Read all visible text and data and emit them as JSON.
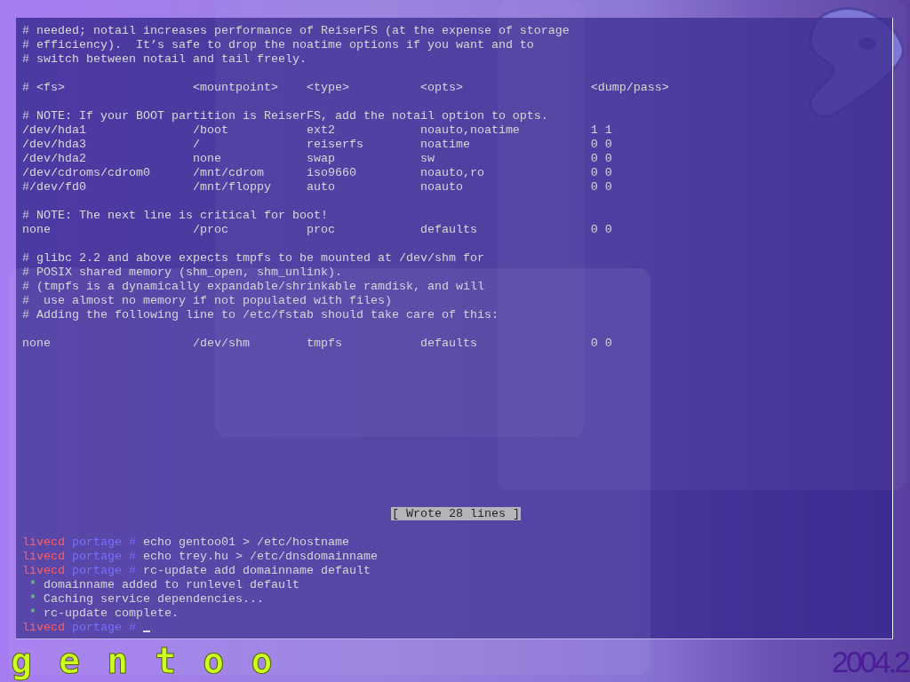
{
  "console": {
    "lines": [
      {
        "kind": "plain",
        "text": "# needed; notail increases performance of ReiserFS (at the expense of storage"
      },
      {
        "kind": "plain",
        "text": "# efficiency).  It’s safe to drop the noatime options if you want and to"
      },
      {
        "kind": "plain",
        "text": "# switch between notail and tail freely."
      },
      {
        "kind": "blank"
      },
      {
        "kind": "plain",
        "text": "# <fs>                  <mountpoint>    <type>          <opts>                  <dump/pass>"
      },
      {
        "kind": "blank"
      },
      {
        "kind": "plain",
        "text": "# NOTE: If your BOOT partition is ReiserFS, add the notail option to opts."
      },
      {
        "kind": "plain",
        "text": "/dev/hda1               /boot           ext2            noauto,noatime          1 1"
      },
      {
        "kind": "plain",
        "text": "/dev/hda3               /               reiserfs        noatime                 0 0"
      },
      {
        "kind": "plain",
        "text": "/dev/hda2               none            swap            sw                      0 0"
      },
      {
        "kind": "plain",
        "text": "/dev/cdroms/cdrom0      /mnt/cdrom      iso9660         noauto,ro               0 0"
      },
      {
        "kind": "plain",
        "text": "#/dev/fd0               /mnt/floppy     auto            noauto                  0 0"
      },
      {
        "kind": "blank"
      },
      {
        "kind": "plain",
        "text": "# NOTE: The next line is critical for boot!"
      },
      {
        "kind": "plain",
        "text": "none                    /proc           proc            defaults                0 0"
      },
      {
        "kind": "blank"
      },
      {
        "kind": "plain",
        "text": "# glibc 2.2 and above expects tmpfs to be mounted at /dev/shm for"
      },
      {
        "kind": "plain",
        "text": "# POSIX shared memory (shm_open, shm_unlink)."
      },
      {
        "kind": "plain",
        "text": "# (tmpfs is a dynamically expandable/shrinkable ramdisk, and will"
      },
      {
        "kind": "plain",
        "text": "#  use almost no memory if not populated with files)"
      },
      {
        "kind": "plain",
        "text": "# Adding the following line to /etc/fstab should take care of this:"
      },
      {
        "kind": "blank"
      },
      {
        "kind": "plain",
        "text": "none                    /dev/shm        tmpfs           defaults                0 0"
      },
      {
        "kind": "blank"
      },
      {
        "kind": "blank"
      },
      {
        "kind": "blank"
      },
      {
        "kind": "blank"
      },
      {
        "kind": "blank"
      },
      {
        "kind": "blank"
      },
      {
        "kind": "blank"
      },
      {
        "kind": "blank"
      },
      {
        "kind": "blank"
      },
      {
        "kind": "blank"
      },
      {
        "kind": "blank"
      },
      {
        "kind": "status",
        "text": "[ Wrote 28 lines ]"
      },
      {
        "kind": "blank"
      },
      {
        "kind": "prompt",
        "host": "livecd",
        "dir": "portage",
        "symbol": "#",
        "command": "echo gentoo01 > /etc/hostname",
        "cursor": false
      },
      {
        "kind": "prompt",
        "host": "livecd",
        "dir": "portage",
        "symbol": "#",
        "command": "echo trey.hu > /etc/dnsdomainname",
        "cursor": false
      },
      {
        "kind": "prompt",
        "host": "livecd",
        "dir": "portage",
        "symbol": "#",
        "command": "rc-update add domainname default",
        "cursor": false
      },
      {
        "kind": "bullet",
        "mark": "*",
        "text": "domainname added to runlevel default"
      },
      {
        "kind": "bullet",
        "mark": "*",
        "text": "Caching service dependencies..."
      },
      {
        "kind": "bullet",
        "mark": "*",
        "text": "rc-update complete."
      },
      {
        "kind": "prompt",
        "host": "livecd",
        "dir": "portage",
        "symbol": "#",
        "cursor": true
      }
    ]
  },
  "logo": {
    "text": "gentoo"
  },
  "version": "2004.2"
}
